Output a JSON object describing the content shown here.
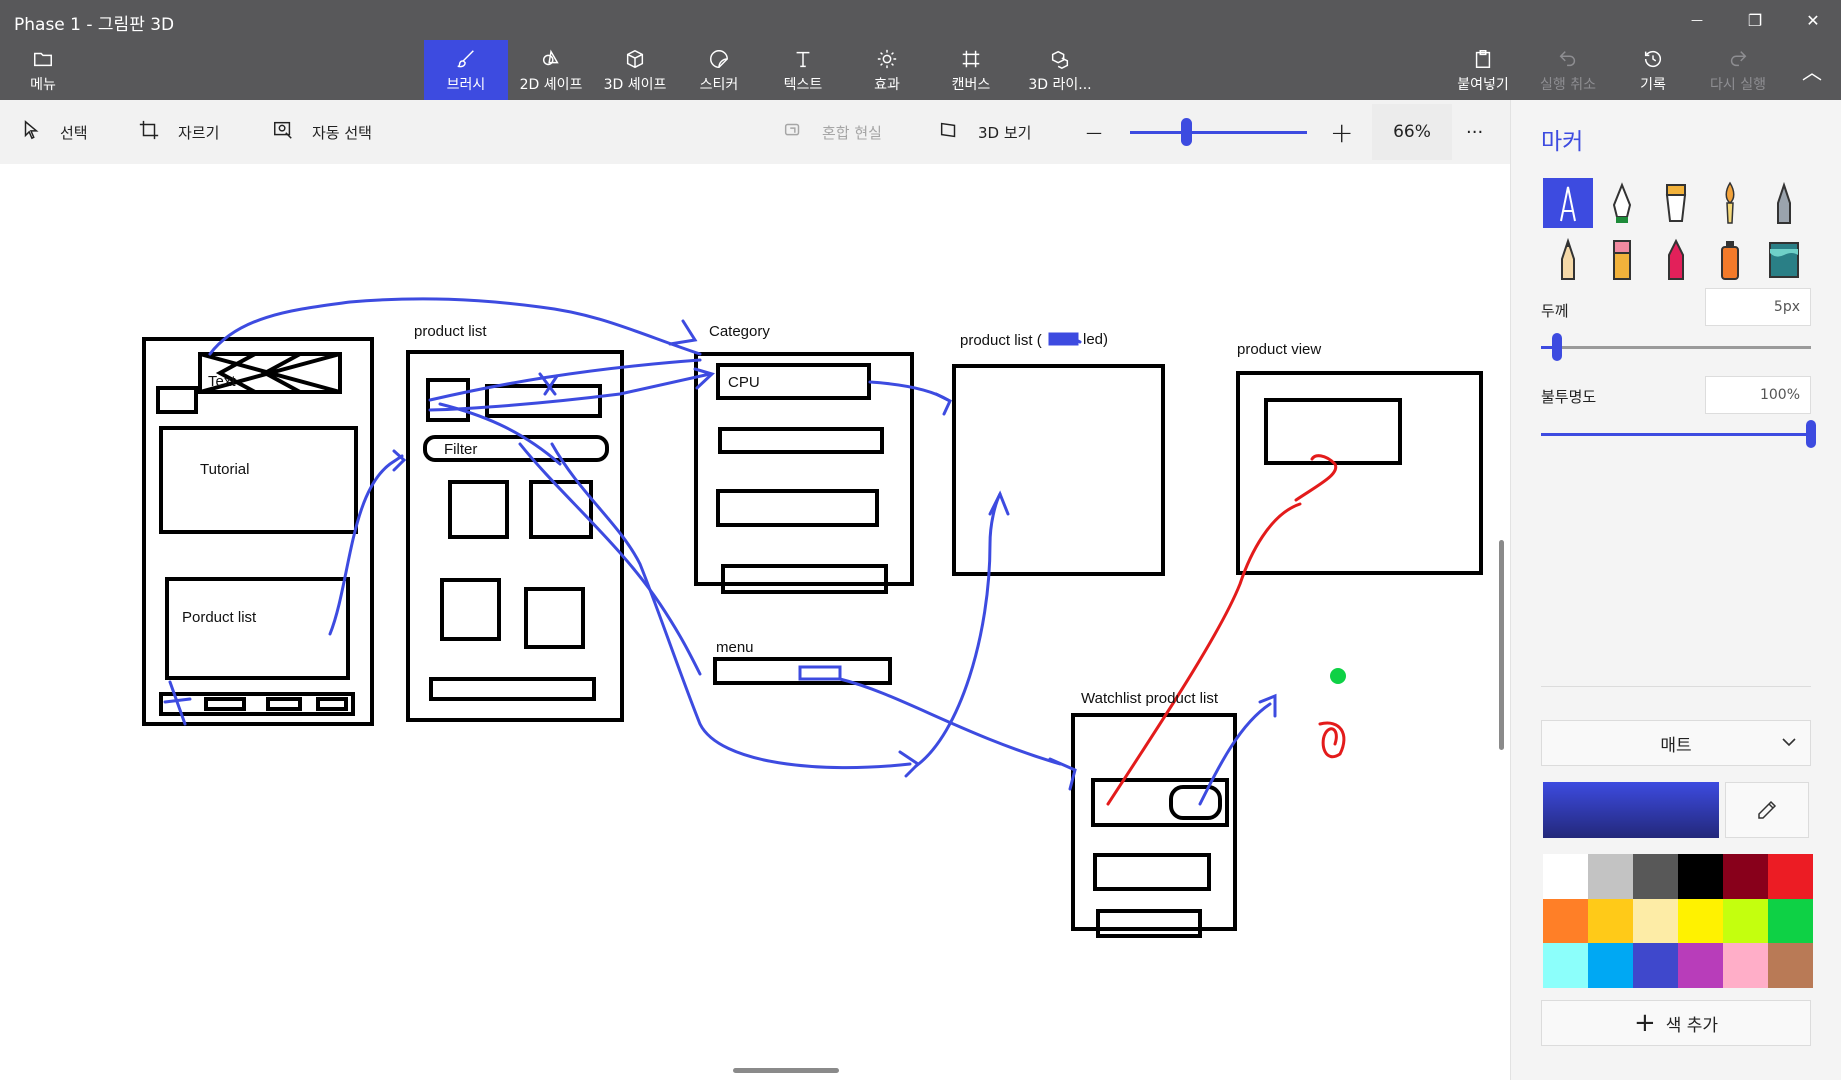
{
  "app": {
    "title": "Phase 1 - 그림판 3D"
  },
  "window_controls": {
    "minimize": "—",
    "restore": "❐",
    "close": "✕"
  },
  "toolbar": {
    "menu": "메뉴",
    "brushes": "브러시",
    "shapes_2d": "2D 셰이프",
    "shapes_3d": "3D 셰이프",
    "stickers": "스티커",
    "text": "텍스트",
    "effects": "효과",
    "canvas": "캔버스",
    "library_3d": "3D 라이...",
    "paste": "붙여넣기",
    "undo": "실행 취소",
    "history": "기록",
    "redo": "다시 실행",
    "collapse_glyph": "︿"
  },
  "subbar": {
    "select": "선택",
    "crop": "자르기",
    "magic_select": "자동 선택",
    "mixed_reality": "혼합 현실",
    "view_3d": "3D 보기",
    "zoom_out": "—",
    "zoom_in": "+",
    "zoom_level": "66%",
    "more": "···"
  },
  "canvas": {
    "labels": {
      "text_box": "Text",
      "tutorial": "Tutorial",
      "porduct_list": "Porduct list",
      "product_list_1": "product list",
      "filter": "Filter",
      "category": "Category",
      "cpu": "CPU",
      "menu": "menu",
      "product_list_2": "product list  (",
      "product_list_2_tail": "led)",
      "product_view": "product view",
      "watchlist": "Watchlist product list"
    }
  },
  "panel": {
    "title": "마커",
    "thickness_label": "두께",
    "thickness_value": "5px",
    "thickness_fraction": 0.06,
    "opacity_label": "불투명도",
    "opacity_value": "100%",
    "opacity_fraction": 1.0,
    "finish": "매트",
    "current_color": "#3d4be0",
    "add_color": "색 추가",
    "tools": [
      "marker",
      "calligraphy-pen",
      "oil-brush",
      "watercolor",
      "pencil-fine",
      "pencil",
      "eraser",
      "crayon",
      "spray-can",
      "fill-bucket"
    ],
    "palette": [
      "#ffffff",
      "#c3c3c3",
      "#585858",
      "#000000",
      "#88001b",
      "#ec1c24",
      "#ff7f27",
      "#ffca18",
      "#fdeca6",
      "#fff200",
      "#c4ff0e",
      "#0ed145",
      "#8cfffb",
      "#00a8f3",
      "#3f48cc",
      "#b83dba",
      "#ffaec8",
      "#b97a56"
    ]
  }
}
